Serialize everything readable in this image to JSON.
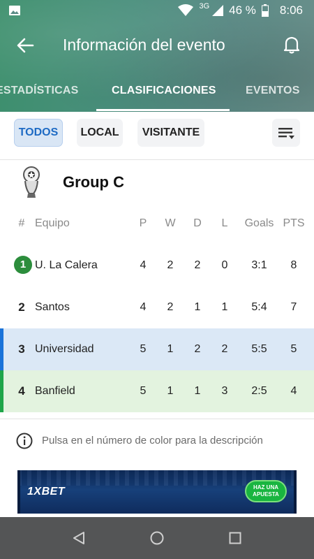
{
  "status_bar": {
    "network": "3G",
    "battery": "46 %",
    "time": "8:06"
  },
  "toolbar": {
    "title": "Información del evento"
  },
  "tabs": [
    {
      "label": "ESTADÍSTICAS"
    },
    {
      "label": "CLASIFICACIONES",
      "active": true
    },
    {
      "label": "EVENTOS"
    }
  ],
  "filters": [
    {
      "label": "TODOS",
      "active": true
    },
    {
      "label": "LOCAL"
    },
    {
      "label": "VISITANTE"
    }
  ],
  "group": {
    "name": "Group C"
  },
  "table": {
    "columns": [
      "#",
      "Equipo",
      "P",
      "W",
      "D",
      "L",
      "Goals",
      "PTS"
    ],
    "rows": [
      {
        "pos": "1",
        "team": "U. La Calera",
        "p": "4",
        "w": "2",
        "d": "2",
        "l": "0",
        "goals": "3:1",
        "pts": "8"
      },
      {
        "pos": "2",
        "team": "Santos",
        "p": "4",
        "w": "2",
        "d": "1",
        "l": "1",
        "goals": "5:4",
        "pts": "7"
      },
      {
        "pos": "3",
        "team": "Universidad",
        "p": "5",
        "w": "1",
        "d": "2",
        "l": "2",
        "goals": "5:5",
        "pts": "5"
      },
      {
        "pos": "4",
        "team": "Banfield",
        "p": "5",
        "w": "1",
        "d": "1",
        "l": "3",
        "goals": "2:5",
        "pts": "4"
      }
    ]
  },
  "info": {
    "text": "Pulsa en el número de color para la descripción"
  },
  "ad": {
    "brand": "1XBET",
    "cta": "HAZ UNA APUESTA"
  },
  "colors": {
    "accent_blue": "#1e6bc4",
    "qualify_green": "#2c8d3c",
    "highlight_blue_bar": "#1a73d9",
    "highlight_green_bar": "#1fa64a",
    "header_green": "#3c8f6c"
  }
}
